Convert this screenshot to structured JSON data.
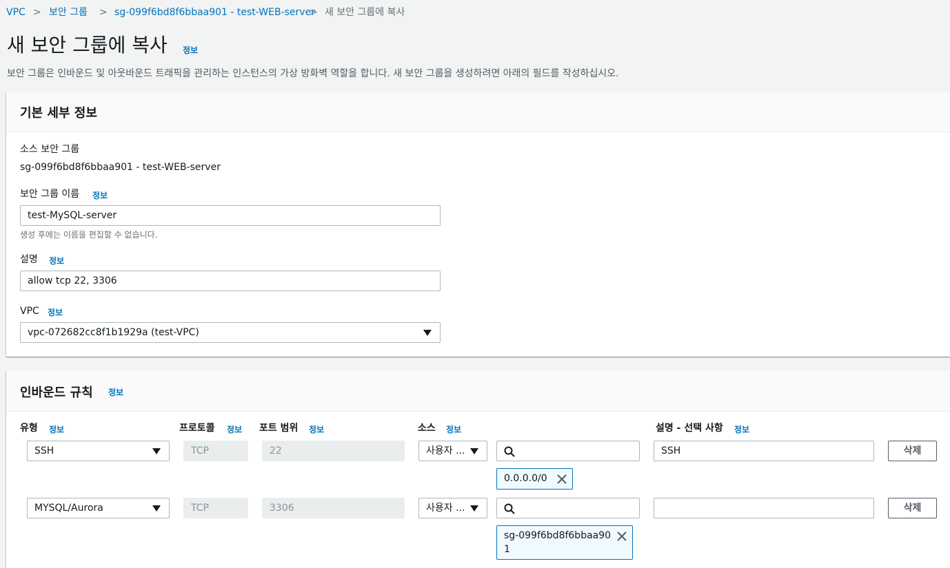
{
  "breadcrumb": {
    "items": [
      "VPC",
      "보안 그룹",
      "sg-099f6bd8f6bbaa901 - test-WEB-server"
    ],
    "current": "새 보안 그룹에 복사",
    "separator": ">"
  },
  "page": {
    "title": "새 보안 그룹에 복사",
    "info": "정보",
    "description": "보안 그룹은 인바운드 및 아웃바운드 트래픽을 관리하는 인스턴스의 가상 방화벽 역할을 합니다. 새 보안 그룹을 생성하려면 아래의 필드를 작성하십시오."
  },
  "basic": {
    "title": "기본 세부 정보",
    "source_label": "소스 보안 그룹",
    "source_value": "sg-099f6bd8f6bbaa901 - test-WEB-server",
    "name_label": "보안 그룹 이름",
    "name_info": "정보",
    "name_value": "test-MySQL-server",
    "name_hint": "생성 후에는 이름을 편집할 수 없습니다.",
    "desc_label": "설명",
    "desc_info": "정보",
    "desc_value": "allow tcp 22, 3306",
    "vpc_label": "VPC",
    "vpc_info": "정보",
    "vpc_value": "vpc-072682cc8f1b1929a (test-VPC)"
  },
  "inbound": {
    "title": "인바운드 규칙",
    "info": "정보",
    "headers": {
      "type": "유형",
      "type_info": "정보",
      "protocol": "프로토콜",
      "protocol_info": "정보",
      "port": "포트 범위",
      "port_info": "정보",
      "source": "소스",
      "source_info": "정보",
      "desc": "설명 - 선택 사항",
      "desc_info": "정보"
    },
    "rows": [
      {
        "type": "SSH",
        "protocol": "TCP",
        "port": "22",
        "source_type": "사용자 ...",
        "search_value": "",
        "token": "0.0.0.0/0",
        "desc": "SSH",
        "delete": "삭제"
      },
      {
        "type": "MYSQL/Aurora",
        "protocol": "TCP",
        "port": "3306",
        "source_type": "사용자 ...",
        "search_value": "",
        "token_line1": "sg-099f6bd8f6bbaa90",
        "token_line2": "1",
        "desc": "",
        "delete": "삭제"
      }
    ]
  },
  "colors": {
    "link": "#0073bb",
    "background": "#f2f3f3",
    "panel": "#ffffff",
    "token_bg": "#f1faff"
  }
}
